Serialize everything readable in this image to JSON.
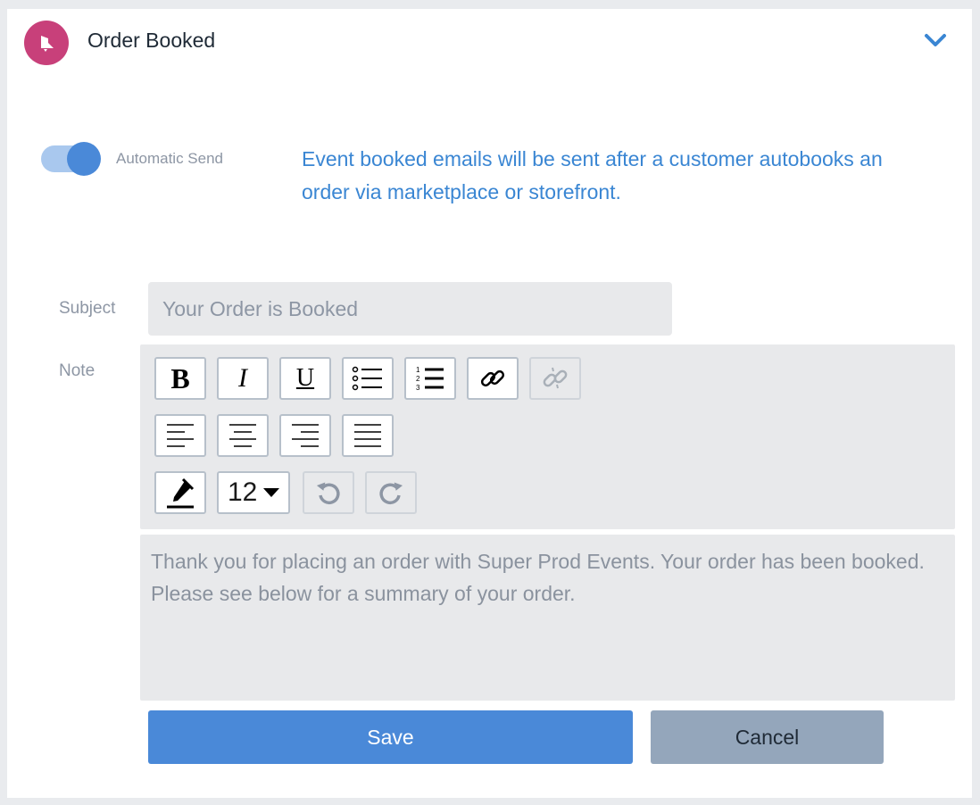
{
  "header": {
    "title": "Order Booked",
    "icon": "bell-icon",
    "icon_color": "#c8407a",
    "expand_icon": "chevron-down-icon"
  },
  "automatic_send": {
    "label": "Automatic Send",
    "enabled": true,
    "accent": "#4a89d8"
  },
  "info": {
    "text": "Event booked emails will be sent after a customer autobooks an order via marketplace or storefront."
  },
  "subject": {
    "label": "Subject",
    "placeholder": "Your Order is Booked",
    "value": ""
  },
  "note": {
    "label": "Note",
    "toolbar": {
      "row1": [
        "bold-icon",
        "italic-icon",
        "underline-icon",
        "bullet-list-icon",
        "numbered-list-icon",
        "link-icon",
        "unlink-icon"
      ],
      "row2": [
        "align-left-icon",
        "align-center-icon",
        "align-right-icon",
        "align-justify-icon"
      ],
      "row3": [
        "text-color-icon",
        "font-size-select",
        "undo-icon",
        "redo-icon"
      ],
      "font_size": "12"
    },
    "body": "Thank you for placing an order with Super Prod Events. Your order has been booked. Please see below for a summary of your order."
  },
  "actions": {
    "save_label": "Save",
    "cancel_label": "Cancel",
    "save_color": "#4a89d8",
    "cancel_color": "#94a6bb"
  }
}
